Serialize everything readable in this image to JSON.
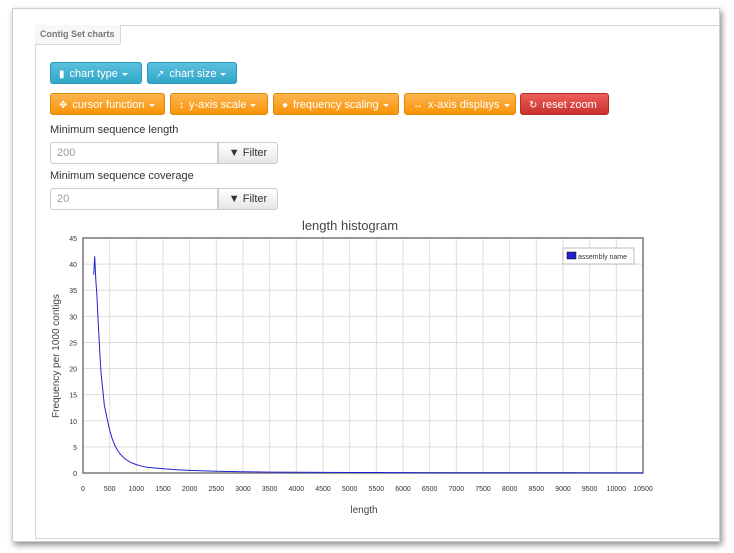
{
  "panel": {
    "tab_label": "Contig Set charts"
  },
  "toolbar1": {
    "chart_type": "chart type",
    "chart_size": "chart size"
  },
  "toolbar2": {
    "cursor_function": "cursor function",
    "y_axis_scale": "y-axis scale",
    "frequency_scaling": "frequency scaling",
    "x_axis_displays": "x-axis displays",
    "reset_zoom": "reset zoom"
  },
  "filters": {
    "min_length_label": "Minimum sequence length",
    "min_length_value": "200",
    "min_coverage_label": "Minimum sequence coverage",
    "min_coverage_value": "20",
    "filter_label": "Filter"
  },
  "colors": {
    "series": "#2222cc",
    "blue_btn": "#31a7c9",
    "orange_btn": "#f89406",
    "red_btn": "#c9302c"
  },
  "chart_data": {
    "type": "line",
    "title": "length histogram",
    "xlabel": "length",
    "ylabel": "Frequency per 1000 contigs",
    "xlim": [
      0,
      10500
    ],
    "ylim": [
      0,
      45
    ],
    "x_ticks": [
      0,
      500,
      1000,
      1500,
      2000,
      2500,
      3000,
      3500,
      4000,
      4500,
      5000,
      5500,
      6000,
      6500,
      7000,
      7500,
      8000,
      8500,
      9000,
      9500,
      10000,
      10500
    ],
    "y_ticks": [
      0,
      5,
      10,
      15,
      20,
      25,
      30,
      35,
      40,
      45
    ],
    "grid": true,
    "legend_position": "top-right",
    "series": [
      {
        "name": "assembly name",
        "x": [
          200,
          220,
          240,
          260,
          280,
          300,
          320,
          340,
          360,
          380,
          400,
          450,
          500,
          550,
          600,
          650,
          700,
          800,
          900,
          1000,
          1100,
          1200,
          1400,
          1600,
          1800,
          2000,
          2500,
          3000,
          3500,
          4000,
          5000,
          6000,
          7000,
          8000,
          9000,
          10000,
          10500
        ],
        "y": [
          38,
          41.5,
          37,
          34,
          30,
          26,
          22,
          19,
          17,
          15,
          13,
          10.5,
          8.2,
          6.5,
          5.2,
          4.3,
          3.6,
          2.6,
          2.0,
          1.6,
          1.3,
          1.1,
          0.9,
          0.75,
          0.6,
          0.5,
          0.35,
          0.25,
          0.18,
          0.14,
          0.1,
          0.07,
          0.05,
          0.04,
          0.03,
          0.02,
          0.02
        ]
      }
    ]
  }
}
